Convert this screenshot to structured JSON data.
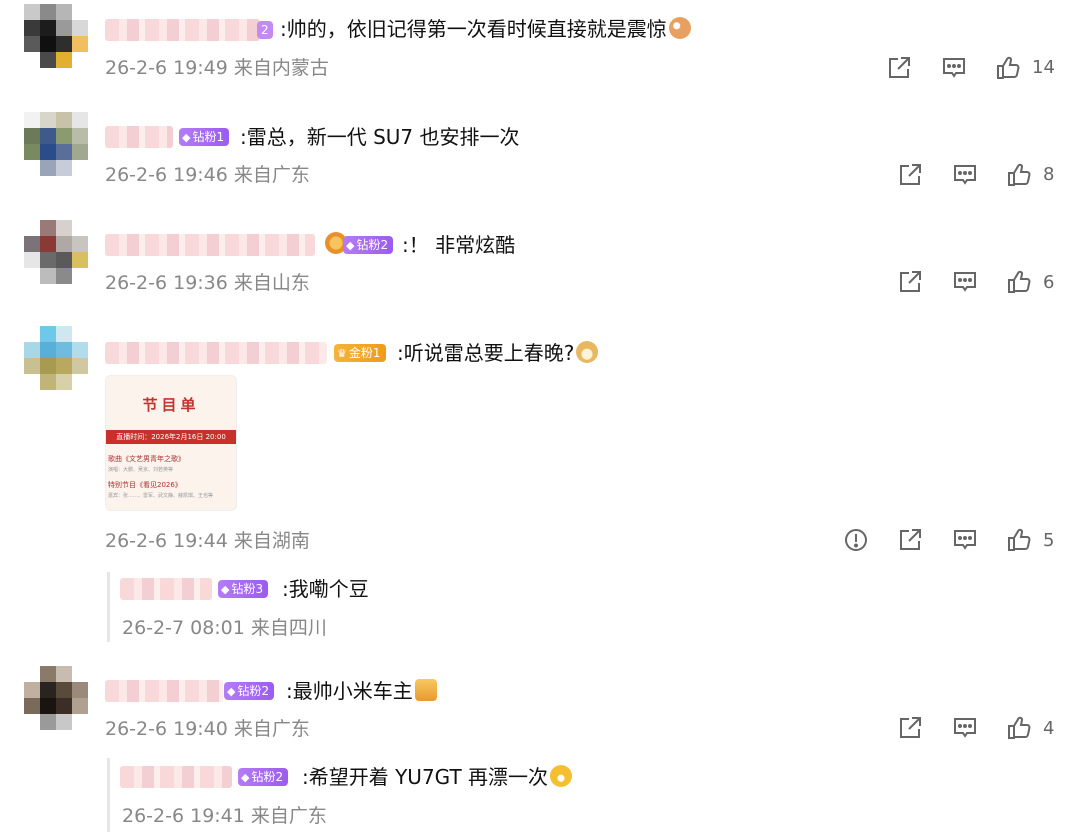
{
  "colors": {
    "text": "#111111",
    "meta": "#888888",
    "badge_diamond": "#9b5cf0",
    "badge_gold": "#f09a1a"
  },
  "comments": [
    {
      "badge": "2",
      "text": ":帅的，依旧记得第一次看时候直接就是震惊",
      "emoji": "cat-emoji",
      "meta": "26-2-6 19:49 来自内蒙古",
      "likes": "14"
    },
    {
      "badge": "钻粉1",
      "text": ":雷总，新一代 SU7 也安排一次",
      "meta": "26-2-6 19:46 来自广东",
      "likes": "8"
    },
    {
      "badge": "钻粉2",
      "text": ":！ 非常炫酷",
      "meta": "26-2-6 19:36 来自山东",
      "likes": "6"
    },
    {
      "badge": "金粉1",
      "text": ":听说雷总要上春晚?",
      "emoji": "doge-emoji",
      "meta": "26-2-6 19:44 来自湖南",
      "likes": "5",
      "image": {
        "title": "节目单",
        "band": "直播时间：2026年2月16日 20:00",
        "line1": "歌曲《文艺男青年之歌》",
        "line1_sub": "演唱：大鹏、吴京、刘若英等",
        "line2": "特别节目《看见2026》",
        "line2_sub": "嘉宾：张……、雷军、武文静、薛凯琪、王也等"
      }
    },
    {
      "badge": "钻粉2",
      "text": ":最帅小米车主",
      "emoji": "thumbs-up-emoji",
      "meta": "26-2-6 19:40 来自广东",
      "likes": "4"
    }
  ],
  "replies": [
    {
      "badge": "钻粉3",
      "text": ":我嘞个豆",
      "meta": "26-2-7 08:01 来自四川"
    },
    {
      "badge": "钻粉2",
      "text": ":希望开着 YU7GT 再漂一次",
      "emoji": "laugh-cry-emoji",
      "meta": "26-2-6 19:41 来自广东"
    }
  ]
}
